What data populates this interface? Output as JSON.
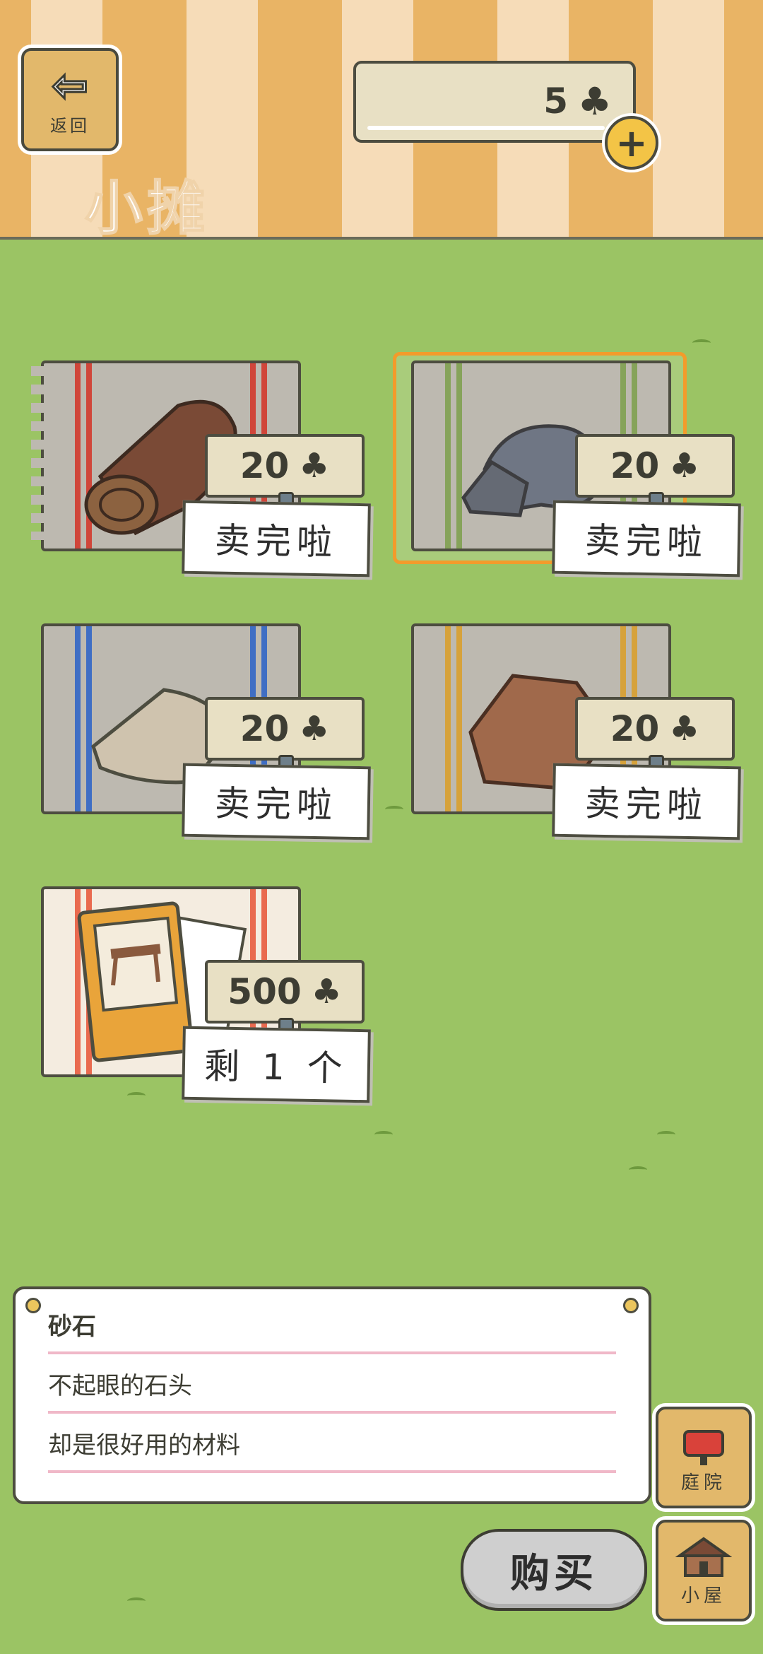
{
  "header": {
    "back_label": "返回",
    "title": "小摊",
    "currency_count": "5",
    "currency_icon": "clover-icon",
    "add_icon": "plus-icon"
  },
  "colors": {
    "grass": "#9bc464",
    "stripe_orange": "#e9b465",
    "selection": "#f39b2b"
  },
  "items": [
    {
      "name": "wood-log",
      "price": "20",
      "status": "卖完啦",
      "stripe": "#d0463a",
      "selected": false
    },
    {
      "name": "gravel-stone",
      "price": "20",
      "status": "卖完啦",
      "stripe": "#86a35a",
      "selected": true
    },
    {
      "name": "cloth-bag",
      "price": "20",
      "status": "卖完啦",
      "stripe": "#3f6ec4",
      "selected": false
    },
    {
      "name": "clay-rock",
      "price": "20",
      "status": "卖完啦",
      "stripe": "#d6a23b",
      "selected": false
    },
    {
      "name": "furniture-catalog",
      "price": "500",
      "status": "剩 1 个",
      "stripe": "#e96a4f",
      "selected": false
    }
  ],
  "info": {
    "item_name": "砂石",
    "desc_line1": "不起眼的石头",
    "desc_line2": "却是很好用的材料"
  },
  "side": {
    "yard_label": "庭院",
    "house_label": "小屋"
  },
  "buy_label": "购买"
}
